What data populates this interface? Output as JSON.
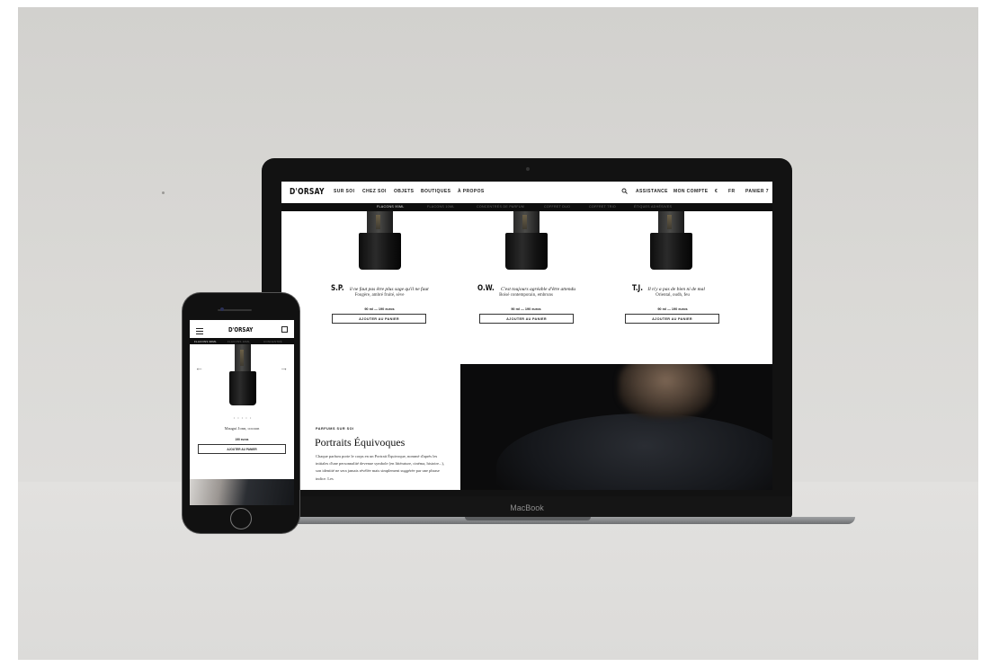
{
  "laptop": {
    "brand_label": "MacBook",
    "site": {
      "logo": "D'ORSAY",
      "nav_left": [
        "SUR SOI",
        "CHEZ SOI",
        "OBJETS",
        "BOUTIQUES",
        "À PROPOS"
      ],
      "nav_right": [
        "ASSISTANCE",
        "MON COMPTE",
        "€",
        "FR",
        "PANIER 7"
      ],
      "search_icon": "search-icon",
      "subnav": [
        {
          "label": "FLACONS 90ML",
          "active": true
        },
        {
          "label": "FLACONS 10ML",
          "active": false
        },
        {
          "label": "CONCENTRÉS DE PARFUM",
          "active": false
        },
        {
          "label": "COFFRET DUO",
          "active": false
        },
        {
          "label": "COFFRET TRIO",
          "active": false
        },
        {
          "label": "ÉTIQUES ADHÉSIVES",
          "active": false
        }
      ],
      "products": [
        {
          "initials": "S.P.",
          "tagline": "il ne faut pas être plus sage qu'il ne faut",
          "notes": "Fougère, ambré fruité, sève",
          "price": "90 ml — 190 euros",
          "cta": "AJOUTER AU PANIER"
        },
        {
          "initials": "O.W.",
          "tagline": "C'est toujours agréable d'être attendu",
          "notes": "Boisé contemporain, embruns",
          "price": "90 ml — 190 euros",
          "cta": "AJOUTER AU PANIER"
        },
        {
          "initials": "T.J.",
          "tagline": "Il n'y a pas de bien ni de mal",
          "notes": "Oriental, oudh, feu",
          "price": "90 ml — 190 euros",
          "cta": "AJOUTER AU PANIER"
        }
      ],
      "section": {
        "eyebrow": "PARFUMS SUR SOI",
        "title": "Portraits Équivoques",
        "body": "Chaque parfum porte le corps en un Portrait Équivoque, nommé d'après les initiales d'une personnalité devenue symbole (en littérature, cinéma, histoire...), son identité ne sera jamais révélée mais simplement suggérée par une phrase indice. Les"
      }
    }
  },
  "phone": {
    "logo": "D'ORSAY",
    "subnav": [
      {
        "label": "FLACONS 90ML",
        "active": true
      },
      {
        "label": "FLACONS 10ML",
        "active": false
      },
      {
        "label": "CONCENTRÉ",
        "active": false
      }
    ],
    "arrow_left": "←",
    "arrow_right": "→",
    "dots": "• • • • •",
    "product_name": "Mauguí Jonn, cocoon",
    "price": "190 euros",
    "cta": "AJOUTER AU PANIER"
  }
}
